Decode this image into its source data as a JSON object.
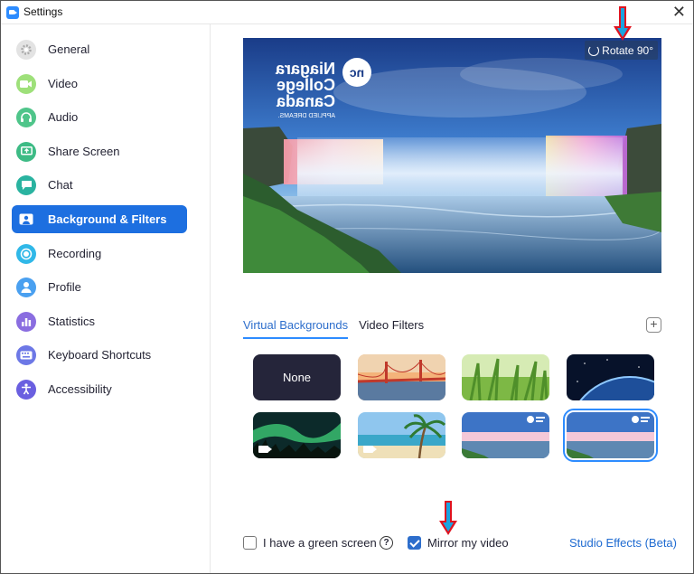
{
  "window": {
    "title": "Settings",
    "close_glyph": "✕"
  },
  "sidebar": {
    "items": [
      {
        "label": "General",
        "icon": "gear-icon",
        "color": "#e0e0e0"
      },
      {
        "label": "Video",
        "icon": "video-camera-icon",
        "color": "#9ee07a"
      },
      {
        "label": "Audio",
        "icon": "headphones-icon",
        "color": "#4fc58a"
      },
      {
        "label": "Share Screen",
        "icon": "share-screen-icon",
        "color": "#3dbb85"
      },
      {
        "label": "Chat",
        "icon": "chat-bubble-icon",
        "color": "#2ab3a0"
      },
      {
        "label": "Background & Filters",
        "icon": "person-background-icon",
        "color": "#1d6fe0",
        "active": true
      },
      {
        "label": "Recording",
        "icon": "record-icon",
        "color": "#30b8e8"
      },
      {
        "label": "Profile",
        "icon": "user-icon",
        "color": "#4aa0f0"
      },
      {
        "label": "Statistics",
        "icon": "bar-chart-icon",
        "color": "#8a6de0"
      },
      {
        "label": "Keyboard Shortcuts",
        "icon": "keyboard-icon",
        "color": "#6d78e6"
      },
      {
        "label": "Accessibility",
        "icon": "accessibility-icon",
        "color": "#6a5fe0"
      }
    ]
  },
  "preview": {
    "rotate_label": "Rotate 90°",
    "logo_initials": "nc",
    "logo_lines": [
      "Niagara",
      "College",
      "Canada"
    ],
    "logo_tagline": "APPLIED DREAMS."
  },
  "tabs": [
    {
      "label": "Virtual Backgrounds",
      "active": true
    },
    {
      "label": "Video Filters",
      "active": false
    }
  ],
  "add_button": "+",
  "backgrounds": [
    {
      "name": "None",
      "kind": "none"
    },
    {
      "name": "golden-gate-bridge",
      "kind": "image"
    },
    {
      "name": "grass",
      "kind": "image"
    },
    {
      "name": "earth-from-space",
      "kind": "image"
    },
    {
      "name": "aurora",
      "kind": "video"
    },
    {
      "name": "beach",
      "kind": "video"
    },
    {
      "name": "niagara-falls-1",
      "kind": "image"
    },
    {
      "name": "niagara-falls-2",
      "kind": "image",
      "selected": true
    }
  ],
  "footer": {
    "green_screen_label": "I have a green screen",
    "green_screen_checked": false,
    "help_glyph": "?",
    "mirror_label": "Mirror my video",
    "mirror_checked": true,
    "studio_effects_label": "Studio Effects (Beta)"
  },
  "colors": {
    "accent": "#2d8cff",
    "annotation_arrow": "#e0131f"
  }
}
